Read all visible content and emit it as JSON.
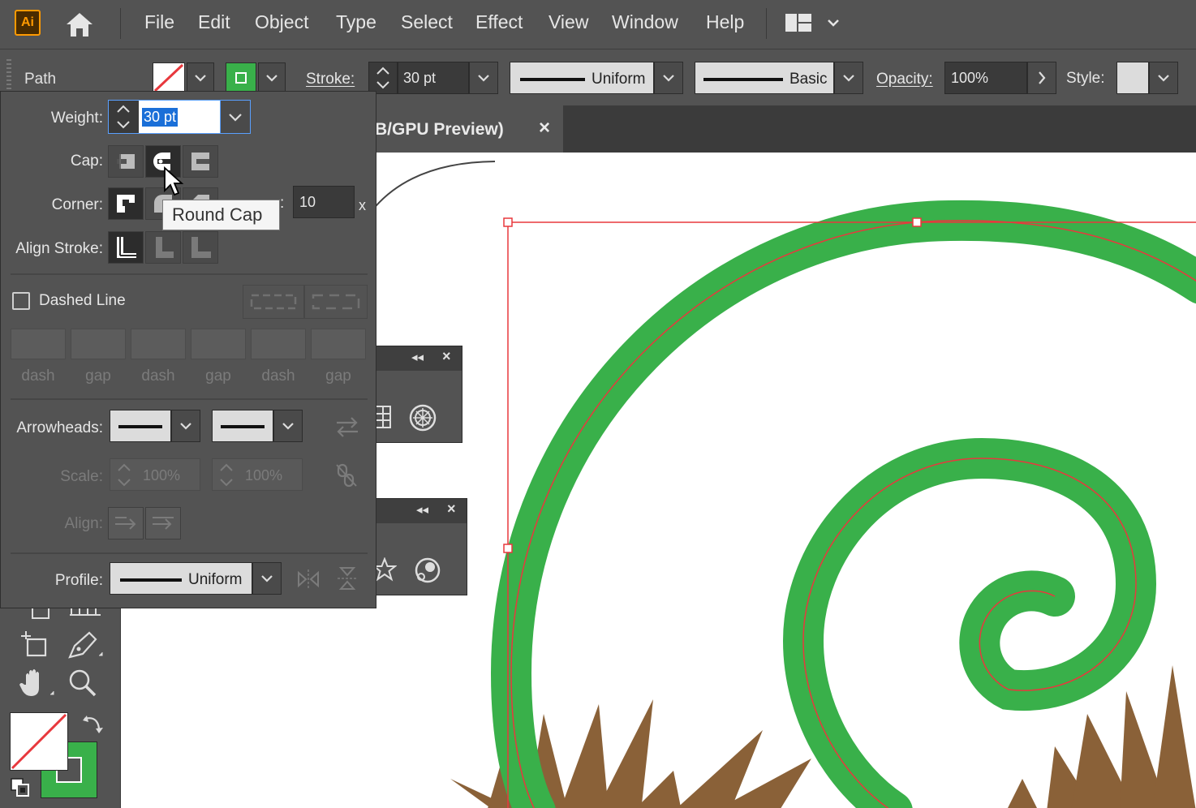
{
  "app": {
    "logo": "Ai",
    "menu": [
      "File",
      "Edit",
      "Object",
      "Type",
      "Select",
      "Effect",
      "View",
      "Window",
      "Help"
    ]
  },
  "control_bar": {
    "selection_label": "Path",
    "stroke_label": "Stroke:",
    "stroke_value": "30 pt",
    "variable_width_profile": "Uniform",
    "brush": "Basic",
    "opacity_label": "Opacity:",
    "opacity_value": "100%",
    "style_label": "Style:"
  },
  "document_tab": {
    "title": "B/GPU Preview)",
    "close": "×"
  },
  "stroke_panel": {
    "weight_label": "Weight:",
    "weight_value": "30 pt",
    "cap_label": "Cap:",
    "corner_label": "Corner:",
    "miter_limit_value": "10",
    "miter_limit_unit": "x",
    "align_stroke_label": "Align Stroke:",
    "dashed_line_label": "Dashed Line",
    "dashed_line_checked": false,
    "dash_labels": [
      "dash",
      "gap",
      "dash",
      "gap",
      "dash",
      "gap"
    ],
    "arrowheads_label": "Arrowheads:",
    "scale_label": "Scale:",
    "scale_start": "100%",
    "scale_end": "100%",
    "align_label": "Align:",
    "profile_label": "Profile:",
    "profile_value": "Uniform"
  },
  "tooltip": {
    "text": "Round Cap"
  },
  "colors": {
    "stroke_green": "#39b04a",
    "selection_red": "#e8383d",
    "spike_brown": "#8a6138",
    "panel_bg": "#535353",
    "accent_orange": "#ff9a00"
  }
}
